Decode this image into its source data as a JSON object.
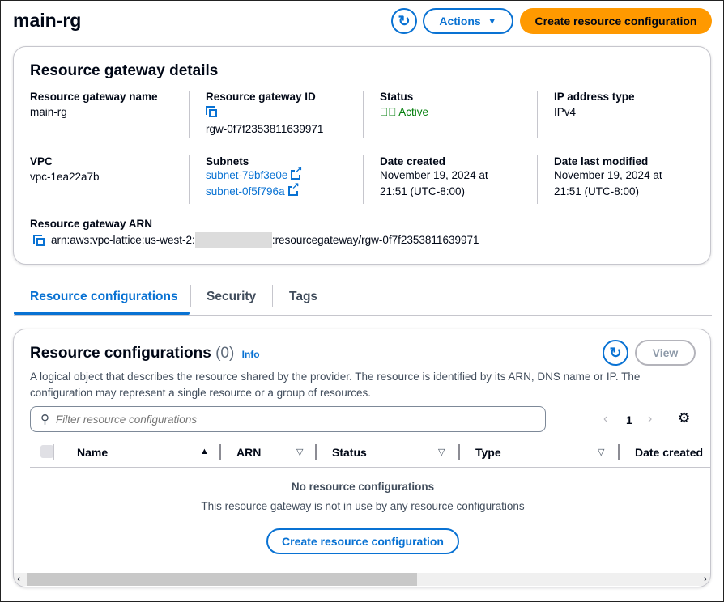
{
  "header": {
    "title": "main-rg",
    "refresh_icon": "refresh-icon",
    "actions_label": "Actions",
    "create_label": "Create resource configuration"
  },
  "details": {
    "title": "Resource gateway details",
    "name_label": "Resource gateway name",
    "name_value": "main-rg",
    "id_label": "Resource gateway ID",
    "id_value": "rgw-0f7f2353811639971",
    "status_label": "Status",
    "status_value": "Active",
    "ip_label": "IP address type",
    "ip_value": "IPv4",
    "vpc_label": "VPC",
    "vpc_value": "vpc-1ea22a7b",
    "subnets_label": "Subnets",
    "subnets": [
      "subnet-79bf3e0e",
      "subnet-0f5f796a"
    ],
    "created_label": "Date created",
    "created_value": [
      "November 19, 2024 at",
      "21:51 (UTC-8:00)"
    ],
    "modified_label": "Date last modified",
    "modified_value": [
      "November 19, 2024 at",
      "21:51 (UTC-8:00)"
    ],
    "arn_label": "Resource gateway ARN",
    "arn_prefix": "arn:aws:vpc-lattice:us-west-2:",
    "arn_suffix": ":resourcegateway/rgw-0f7f2353811639971"
  },
  "tabs": [
    {
      "label": "Resource configurations",
      "active": true
    },
    {
      "label": "Security"
    },
    {
      "label": "Tags"
    }
  ],
  "configs": {
    "title": "Resource configurations",
    "count": "(0)",
    "info": "Info",
    "view_label": "View",
    "description": "A logical object that describes the resource shared by the provider. The resource is identified by its ARN, DNS name or IP. The configuration may represent a single resource or a group of resources.",
    "filter_placeholder": "Filter resource configurations",
    "page": "1",
    "columns": [
      "Name",
      "ARN",
      "Status",
      "Type",
      "Date created"
    ],
    "empty_title": "No resource configurations",
    "empty_text": "This resource gateway is not in use by any resource configurations",
    "empty_button": "Create resource configuration"
  },
  "colors": {
    "accent": "#0972d3",
    "primary": "#ff9900",
    "success": "#037f0c"
  }
}
